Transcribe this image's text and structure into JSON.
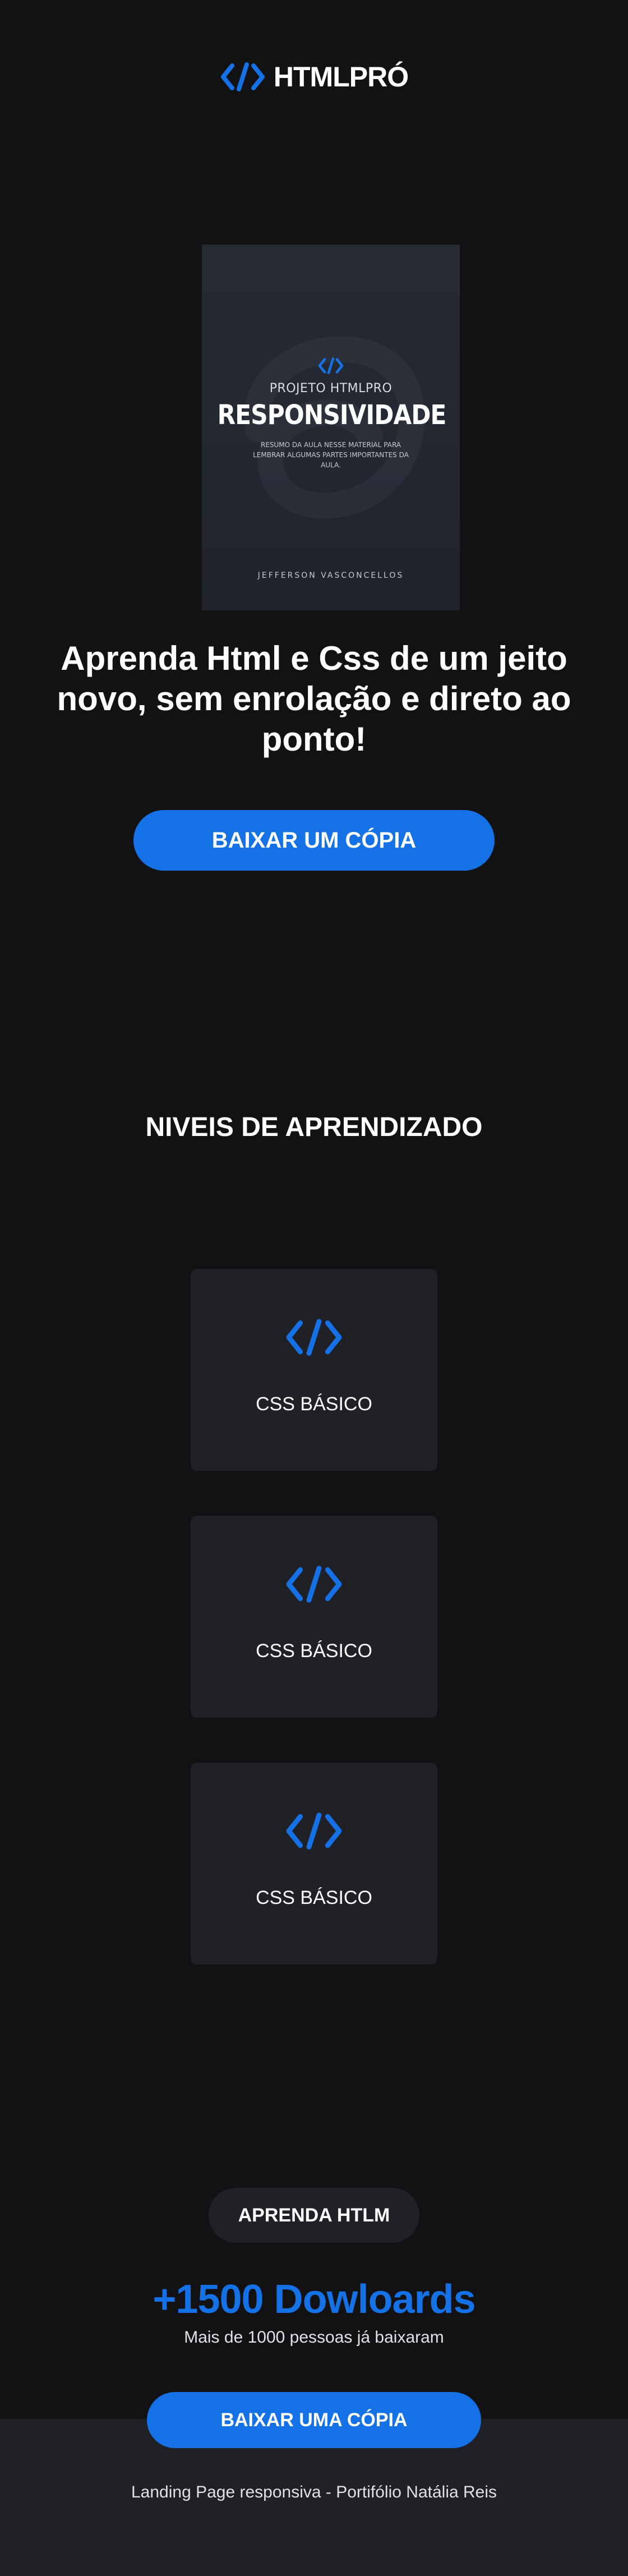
{
  "header": {
    "logo_text": "HTMLPRÓ"
  },
  "book": {
    "project_label": "PROJETO HTMLPRO",
    "title": "RESPONSIVIDADE",
    "description": "RESUMO DA AULA NESSE MATERIAL PARA LEMBRAR ALGUMAS PARTES IMPORTANTES DA AULA.",
    "author": "JEFFERSON VASCONCELLOS"
  },
  "hero": {
    "headline": "Aprenda Html e Css de um jeito novo, sem enrolação e direto ao ponto!",
    "cta_label": "BAIXAR UM CÓPIA"
  },
  "levels": {
    "title": "NIVEIS DE APRENDIZADO",
    "cards": [
      {
        "label": "CSS BÁSICO"
      },
      {
        "label": "CSS BÁSICO"
      },
      {
        "label": "CSS BÁSICO"
      }
    ]
  },
  "stats": {
    "pill_label": "APRENDA HTLM",
    "downloads": "+1500 Dowloards",
    "subtitle": "Mais de 1000 pessoas já baixaram"
  },
  "footer": {
    "cta_label": "BAIXAR UMA CÓPIA",
    "credit": "Landing Page responsiva - Portifólio Natália Reis"
  },
  "colors": {
    "background": "#121214",
    "surface": "#202027",
    "accent": "#1471e6",
    "text": "#ffffff"
  },
  "icons": {
    "logo": "code-icon",
    "card": "code-icon"
  }
}
